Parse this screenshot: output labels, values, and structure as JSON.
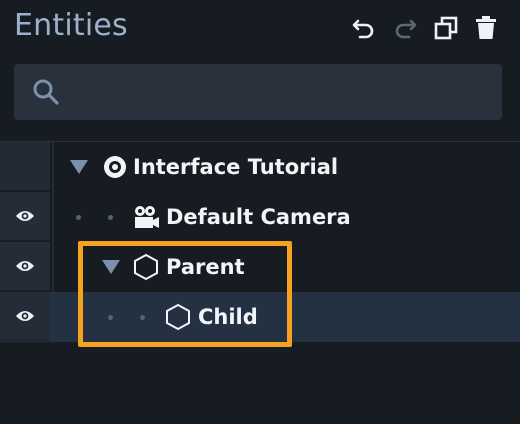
{
  "panel": {
    "title": "Entities",
    "toolbar": {
      "undo_icon": "undo-icon",
      "redo_icon": "redo-icon",
      "duplicate_icon": "duplicate-icon",
      "delete_icon": "trash-icon"
    },
    "search": {
      "icon": "search-icon",
      "value": "",
      "placeholder": ""
    }
  },
  "tree": {
    "rows": [
      {
        "label": "Interface Tutorial",
        "icon": "scene-icon",
        "expanded": true,
        "visibility_toggle": false,
        "selected": false
      },
      {
        "label": "Default Camera",
        "icon": "camera-icon",
        "expanded": null,
        "visibility_toggle": true,
        "selected": false
      },
      {
        "label": "Parent",
        "icon": "entity-icon",
        "expanded": true,
        "visibility_toggle": true,
        "selected": false
      },
      {
        "label": "Child",
        "icon": "entity-icon",
        "expanded": null,
        "visibility_toggle": true,
        "selected": true
      }
    ]
  },
  "colors": {
    "background": "#171c23",
    "title": "#9bb1c9",
    "search_bg": "#29313d",
    "selected_row": "#243142",
    "highlight": "#f5a21e",
    "caret": "#7b90ab"
  }
}
